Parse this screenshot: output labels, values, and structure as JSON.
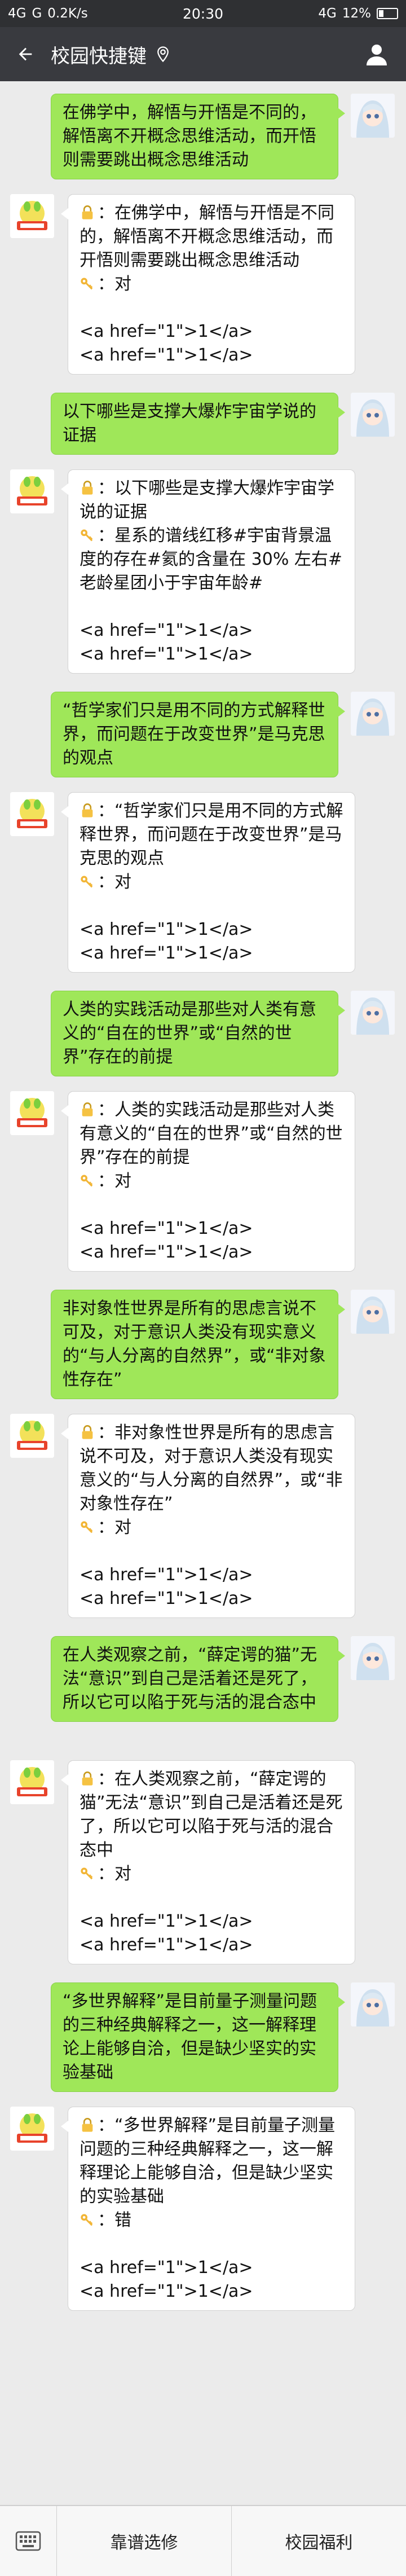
{
  "status": {
    "network": "4G",
    "carrier": "G",
    "speed": "0.2K/s",
    "time": "20:30",
    "signal": "4G",
    "battery": "12%"
  },
  "header": {
    "title": "校园快捷键"
  },
  "colors": {
    "user_bubble": "#9fe759",
    "bot_bubble": "#ffffff",
    "header": "#393a3f",
    "background": "#ebebeb"
  },
  "icons": {
    "back": "back-arrow-icon",
    "location": "location-pin-icon",
    "profile": "person-icon",
    "lock": "lock-icon",
    "key": "key-icon",
    "keyboard": "keyboard-icon"
  },
  "messages": [
    {
      "user": "在佛学中，解悟与开悟是不同的，解悟离不开概念思维活动，而开悟则需要跳出概念思维活动",
      "reply_q": "：在佛学中，解悟与开悟是不同的，解悟离不开概念思维活动，而开悟则需要跳出概念思维活动",
      "reply_a": "：对",
      "links": [
        "<a href=\"1\">1</a>",
        "<a href=\"1\">1</a>"
      ]
    },
    {
      "user": "以下哪些是支撑大爆炸宇宙学说的证据",
      "reply_q": "：以下哪些是支撑大爆炸宇宙学说的证据",
      "reply_a": "：星系的谱线红移#宇宙背景温度的存在#氦的含量在 30% 左右#老龄星团小于宇宙年龄#",
      "links": [
        "<a href=\"1\">1</a>",
        "<a href=\"1\">1</a>"
      ]
    },
    {
      "user": "“哲学家们只是用不同的方式解释世界，而问题在于改变世界”是马克思的观点",
      "reply_q": "：“哲学家们只是用不同的方式解释世界，而问题在于改变世界”是马克思的观点",
      "reply_a": "：对",
      "links": [
        "<a href=\"1\">1</a>",
        "<a href=\"1\">1</a>"
      ]
    },
    {
      "user": "人类的实践活动是那些对人类有意义的“自在的世界”或“自然的世界”存在的前提",
      "reply_q": "：人类的实践活动是那些对人类有意义的“自在的世界”或“自然的世界”存在的前提",
      "reply_a": "：对",
      "links": [
        "<a href=\"1\">1</a>",
        "<a href=\"1\">1</a>"
      ]
    },
    {
      "user": "非对象性世界是所有的思虑言说不可及，对于意识人类没有现实意义的“与人分离的自然界”，或“非对象性存在”",
      "reply_q": "：非对象性世界是所有的思虑言说不可及，对于意识人类没有现实意义的“与人分离的自然界”，或“非对象性存在”",
      "reply_a": "：对",
      "links": [
        "<a href=\"1\">1</a>",
        "<a href=\"1\">1</a>"
      ]
    },
    {
      "user": "在人类观察之前，“薛定谔的猫”无法“意识”到自己是活着还是死了，所以它可以陷于死与活的混合态中",
      "reply_q": "：在人类观察之前，“薛定谔的猫”无法“意识”到自己是活着还是死了，所以它可以陷于死与活的混合态中",
      "reply_a": "：对",
      "links": [
        "<a href=\"1\">1</a>",
        "<a href=\"1\">1</a>"
      ]
    },
    {
      "user": "“多世界解释”是目前量子测量问题的三种经典解释之一，这一解释理论上能够自洽，但是缺少坚实的实验基础",
      "reply_q": "：“多世界解释”是目前量子测量问题的三种经典解释之一，这一解释理论上能够自洽，但是缺少坚实的实验基础",
      "reply_a": "：错",
      "links": [
        "<a href=\"1\">1</a>",
        "<a href=\"1\">1</a>"
      ]
    }
  ],
  "bottom_menu": [
    "靠谱选修",
    "校园福利"
  ]
}
